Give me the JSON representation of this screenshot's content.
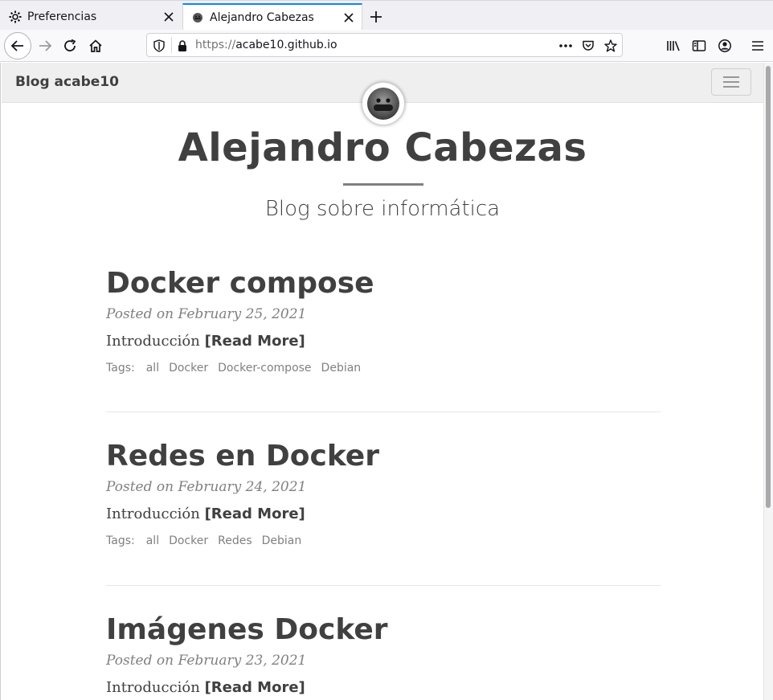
{
  "browser": {
    "tabs": [
      {
        "title": "Preferencias",
        "icon": "gear-icon",
        "active": false
      },
      {
        "title": "Alejandro Cabezas",
        "icon": "site-favicon",
        "active": true
      }
    ],
    "url": {
      "scheme": "https://",
      "host": "acabe10.github.io"
    },
    "accent": "#0a84ff"
  },
  "site": {
    "brand": "Blog acabe10",
    "title": "Alejandro Cabezas",
    "subtitle": "Blog sobre informática"
  },
  "posts": [
    {
      "title": "Docker compose",
      "meta": "Posted on February 25, 2021",
      "excerpt": "Introducción",
      "read_more": "[Read More]",
      "tags_label": "Tags:",
      "tags": [
        "all",
        "Docker",
        "Docker-compose",
        "Debian"
      ]
    },
    {
      "title": "Redes en Docker",
      "meta": "Posted on February 24, 2021",
      "excerpt": "Introducción",
      "read_more": "[Read More]",
      "tags_label": "Tags:",
      "tags": [
        "all",
        "Docker",
        "Redes",
        "Debian"
      ]
    },
    {
      "title": "Imágenes Docker",
      "meta": "Posted on February 23, 2021",
      "excerpt": "Introducción",
      "read_more": "[Read More]",
      "tags_label": "Tags:",
      "tags": []
    }
  ]
}
